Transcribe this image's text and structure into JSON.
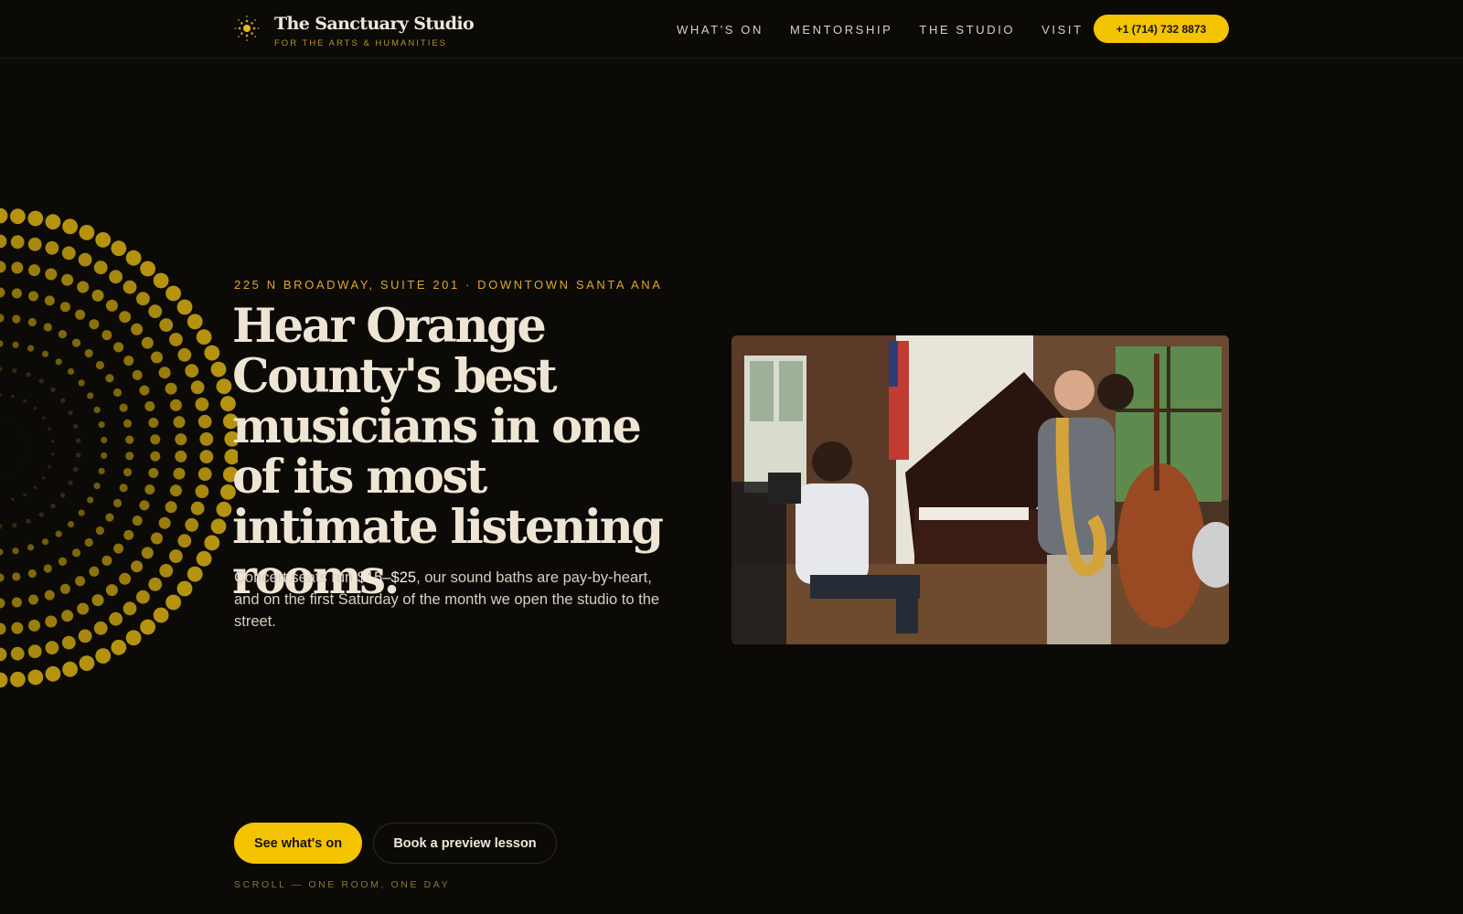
{
  "header": {
    "brand_name": "The Sanctuary Studio",
    "brand_tagline": "FOR THE ARTS & HUMANITIES",
    "nav": [
      "WHAT'S ON",
      "MENTORSHIP",
      "THE STUDIO",
      "VISIT"
    ],
    "phone": "+1 (714) 732 8873"
  },
  "hero": {
    "address": "225 N BROADWAY, SUITE 201 · DOWNTOWN SANTA ANA",
    "headline": "Hear Orange County's best musicians in one of its most intimate listening rooms.",
    "lede_before": "Concert seats run ",
    "lede_price": "$15–$25",
    "lede_after": ", our sound baths are pay-by-heart, and on the first Saturday of the month we open the studio to the street.",
    "cta_primary": "See what's on",
    "cta_secondary": "Book a preview lesson",
    "scroll_hint": "SCROLL — ONE ROOM, ONE DAY",
    "photo_icon": "jazz-trio-photo"
  },
  "colors": {
    "background": "#0c0a07",
    "accent": "#f5c400",
    "accent_text": "#e0a825",
    "text": "#efe5d4"
  }
}
